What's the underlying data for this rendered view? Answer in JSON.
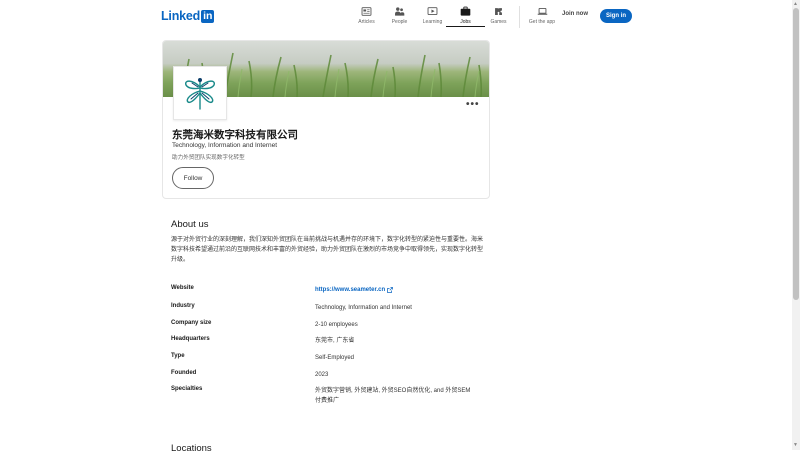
{
  "header": {
    "logo_text": "Linked",
    "logo_box": "in",
    "nav": [
      {
        "label": "Articles",
        "icon": "articles-icon"
      },
      {
        "label": "People",
        "icon": "people-icon"
      },
      {
        "label": "Learning",
        "icon": "learning-icon"
      },
      {
        "label": "Jobs",
        "icon": "jobs-icon",
        "active": true
      },
      {
        "label": "Games",
        "icon": "games-icon"
      },
      {
        "label": "Get the app",
        "icon": "laptop-icon"
      }
    ],
    "join_label": "Join now",
    "signin_label": "Sign in"
  },
  "company": {
    "name": "东莞海米数字科技有限公司",
    "industry": "Technology, Information and Internet",
    "tagline": "助力外贸团队实现数字化转型",
    "follow_label": "Follow",
    "more_label": "•••"
  },
  "about": {
    "title": "About us",
    "description": "源于对外贸行业的深刻理解，我们深知外贸团队在当前挑战与机遇并存的环境下，数字化转型的紧迫性与重要性。海米数字科技希望通过前沿的互联网技术和丰富的外贸经验，助力外贸团队在激烈的市场竞争中取得领先，实现数字化转型升级。",
    "details": [
      {
        "label": "Website",
        "value": "https://www.seameter.cn",
        "is_link": true
      },
      {
        "label": "Industry",
        "value": "Technology, Information and Internet"
      },
      {
        "label": "Company size",
        "value": "2-10 employees"
      },
      {
        "label": "Headquarters",
        "value": "东莞市, 广东省"
      },
      {
        "label": "Type",
        "value": "Self-Employed"
      },
      {
        "label": "Founded",
        "value": "2023"
      },
      {
        "label": "Specialties",
        "value": "外贸数字营销, 外贸建站, 外贸SEO自然优化, and 外贸SEM付费推广"
      }
    ]
  },
  "locations": {
    "title": "Locations"
  },
  "colors": {
    "brand": "#0a66c2",
    "text": "#191919",
    "muted": "#666666"
  }
}
